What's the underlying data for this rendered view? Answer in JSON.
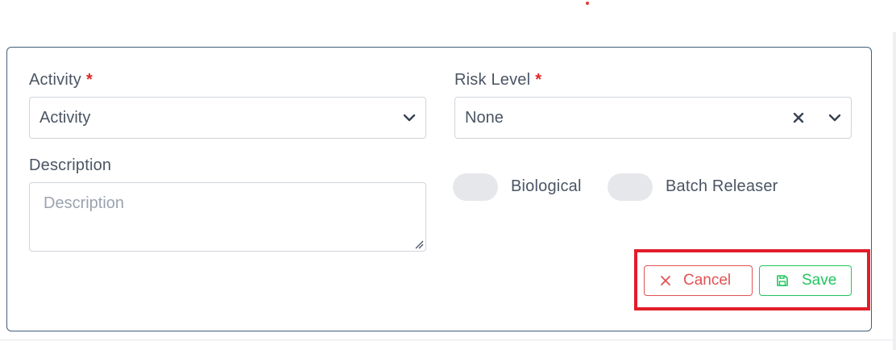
{
  "form": {
    "activity": {
      "label": "Activity",
      "required_mark": "*",
      "value": "Activity"
    },
    "risk_level": {
      "label": "Risk Level",
      "required_mark": "*",
      "value": "None"
    },
    "description": {
      "label": "Description",
      "placeholder": "Description",
      "value": ""
    },
    "toggles": [
      {
        "label": "Biological",
        "checked": false
      },
      {
        "label": "Batch Releaser",
        "checked": false
      }
    ]
  },
  "actions": {
    "cancel_label": "Cancel",
    "save_label": "Save"
  },
  "colors": {
    "cancel": "#e05252",
    "save": "#22c55e",
    "highlight": "#e11d2a",
    "required": "#dc2626"
  },
  "icons": {
    "select_arrow": "chevron-down-icon",
    "clear": "clear-x-icon",
    "cancel": "close-icon",
    "save": "floppy-disk-icon"
  }
}
